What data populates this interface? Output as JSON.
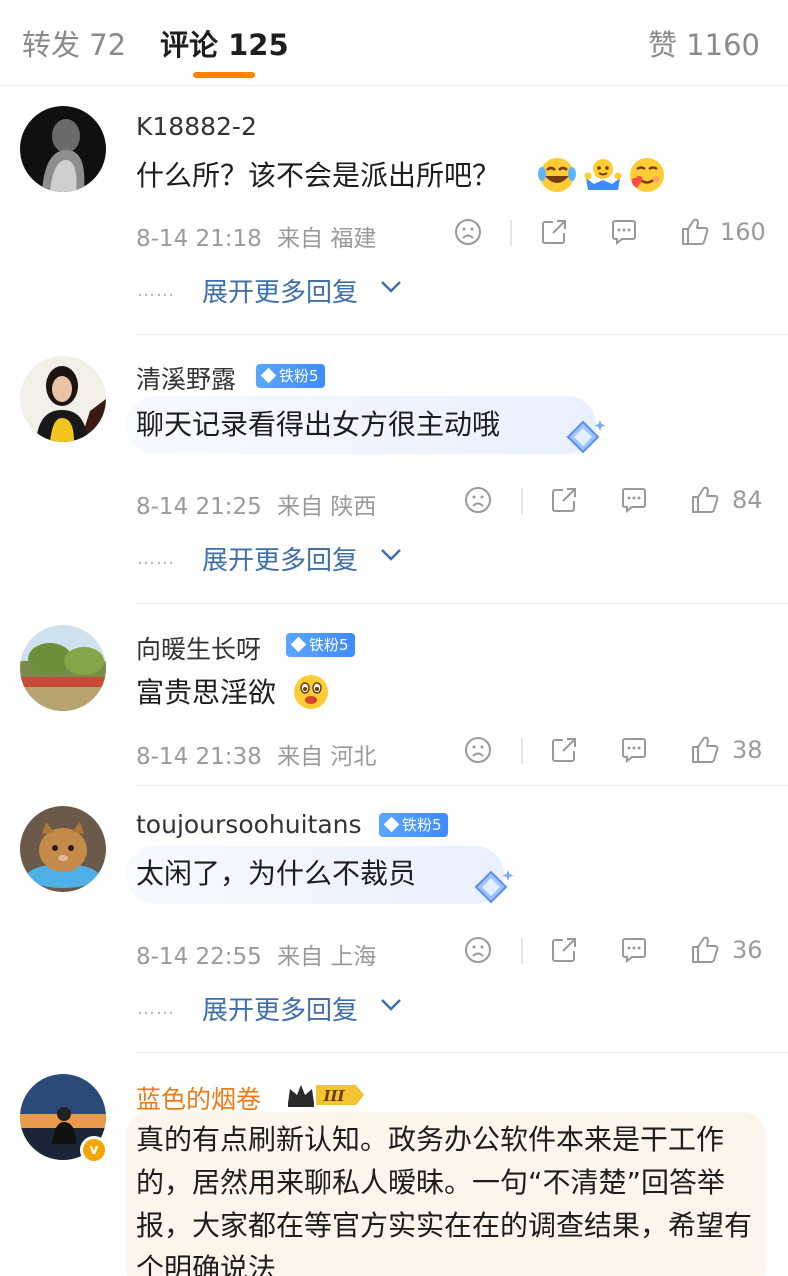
{
  "tabs": {
    "repost": "转发 72",
    "comments": "评论 125",
    "likes": "赞 1160"
  },
  "colors": {
    "accent": "#ff8200",
    "link": "#3f6eaa",
    "vip_name": "#ee7a16",
    "fan_badge": "#3d8bff"
  },
  "more_replies_label": "展开更多回复",
  "more_dots": "……",
  "comments": [
    {
      "username": "K18882-2",
      "text": "什么所？该不会是派出所吧？",
      "emojis": [
        "laugh-cry-emoji",
        "shrug-emoji",
        "heart-face-emoji"
      ],
      "time": "8-14 21:18",
      "source": "来自 福建",
      "likes": "160"
    },
    {
      "username": "清溪野露",
      "badge": "铁粉5",
      "text": "聊天记录看得出女方很主动哦",
      "time": "8-14 21:25",
      "source": "来自 陕西",
      "likes": "84"
    },
    {
      "username": "向暖生长呀",
      "badge": "铁粉5",
      "text": "富贵思淫欲",
      "emojis": [
        "drool-emoji"
      ],
      "time": "8-14 21:38",
      "source": "来自 河北",
      "likes": "38"
    },
    {
      "username": "toujoursoohuitans",
      "badge": "铁粉5",
      "text": "太闲了，为什么不裁员",
      "time": "8-14 22:55",
      "source": "来自 上海",
      "likes": "36"
    },
    {
      "username": "蓝色的烟卷",
      "vip_badge": "III",
      "text": "真的有点刷新认知。政务办公软件本来是干工作的，居然用来聊私人暧昧。一句“不清楚”回答举报，大家都在等官方实实在在的调查结果，希望有个明确说法"
    }
  ]
}
